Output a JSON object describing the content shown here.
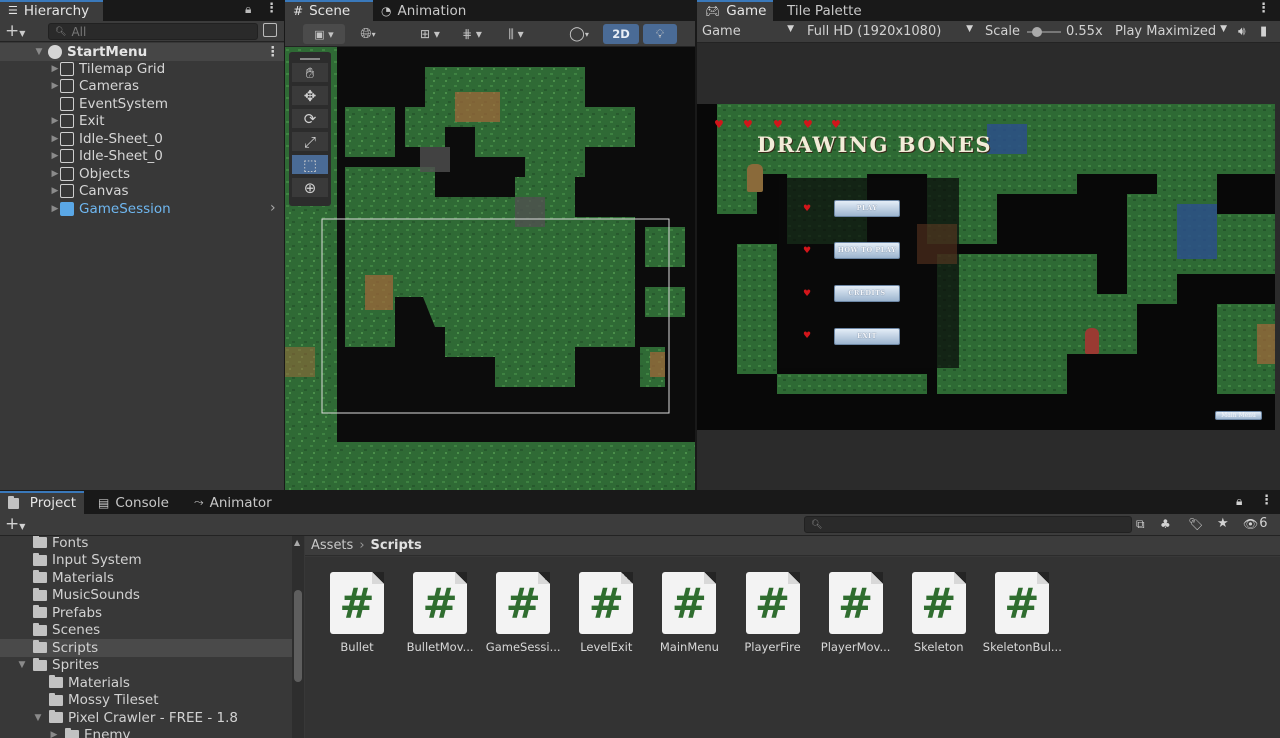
{
  "hierarchy": {
    "tab": "Hierarchy",
    "search_placeholder": "All",
    "scene_name": "StartMenu",
    "items": [
      {
        "label": "Tilemap Grid",
        "expandable": true
      },
      {
        "label": "Cameras",
        "expandable": true
      },
      {
        "label": "EventSystem",
        "expandable": false
      },
      {
        "label": "Exit",
        "expandable": true
      },
      {
        "label": "Idle-Sheet_0",
        "expandable": true
      },
      {
        "label": "Idle-Sheet_0",
        "expandable": true
      },
      {
        "label": "Objects",
        "expandable": true
      },
      {
        "label": "Canvas",
        "expandable": true
      },
      {
        "label": "GameSession",
        "expandable": true,
        "prefab": true
      }
    ]
  },
  "scene": {
    "tabs": [
      "Scene",
      "Animation"
    ],
    "toggle_2d": "2D",
    "tools": [
      "hand-tool-icon",
      "move-tool-icon",
      "rotate-tool-icon",
      "scale-tool-icon",
      "rect-tool-icon",
      "transform-tool-icon"
    ]
  },
  "game": {
    "tabs": [
      "Game",
      "Tile Palette"
    ],
    "display": "Game",
    "resolution": "Full HD (1920x1080)",
    "scale_label": "Scale",
    "scale_value": "0.55x",
    "scale_fraction": 0.15,
    "play_mode": "Play Maximized",
    "title": "DRAWING BONES",
    "menu_buttons": [
      "PLAY",
      "HOW TO PLAY",
      "CREDITS",
      "EXIT"
    ],
    "corner_button": "Main Menu"
  },
  "project": {
    "tabs": [
      "Project",
      "Console",
      "Animator"
    ],
    "badge_count": "6",
    "breadcrumb": [
      "Assets",
      "Scripts"
    ],
    "tree": [
      {
        "label": "Fonts",
        "indent": 0,
        "arrow": ""
      },
      {
        "label": "Input System",
        "indent": 0,
        "arrow": ""
      },
      {
        "label": "Materials",
        "indent": 0,
        "arrow": ""
      },
      {
        "label": "MusicSounds",
        "indent": 0,
        "arrow": ""
      },
      {
        "label": "Prefabs",
        "indent": 0,
        "arrow": ""
      },
      {
        "label": "Scenes",
        "indent": 0,
        "arrow": ""
      },
      {
        "label": "Scripts",
        "indent": 0,
        "arrow": "",
        "selected": true
      },
      {
        "label": "Sprites",
        "indent": 0,
        "arrow": "▼"
      },
      {
        "label": "Materials",
        "indent": 1,
        "arrow": ""
      },
      {
        "label": "Mossy Tileset",
        "indent": 1,
        "arrow": ""
      },
      {
        "label": "Pixel Crawler - FREE - 1.8",
        "indent": 1,
        "arrow": "▼"
      },
      {
        "label": "Enemy",
        "indent": 2,
        "arrow": "▶"
      }
    ],
    "assets": [
      "Bullet",
      "BulletMov...",
      "GameSessi...",
      "LevelExit",
      "MainMenu",
      "PlayerFire",
      "PlayerMov...",
      "Skeleton",
      "SkeletonBul..."
    ],
    "asset_glyph": "#"
  }
}
